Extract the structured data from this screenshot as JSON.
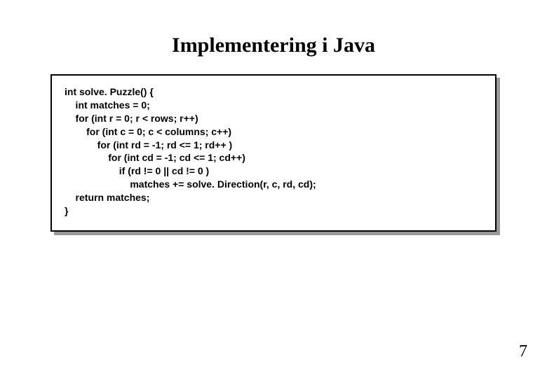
{
  "title": "Implementering i Java",
  "code": {
    "l1": "int solve. Puzzle() {",
    "l2": "    int matches = 0;",
    "l3": "",
    "l4": "    for (int r = 0; r < rows; r++)",
    "l5": "        for (int c = 0; c < columns; c++)",
    "l6": "            for (int rd = -1; rd <= 1; rd++ )",
    "l7": "                for (int cd = -1; cd <= 1; cd++)",
    "l8": "                    if (rd != 0 || cd != 0 )",
    "l9": "                        matches += solve. Direction(r, c, rd, cd);",
    "l10": "",
    "l11": "    return matches;",
    "l12": "}"
  },
  "page_number": "7"
}
